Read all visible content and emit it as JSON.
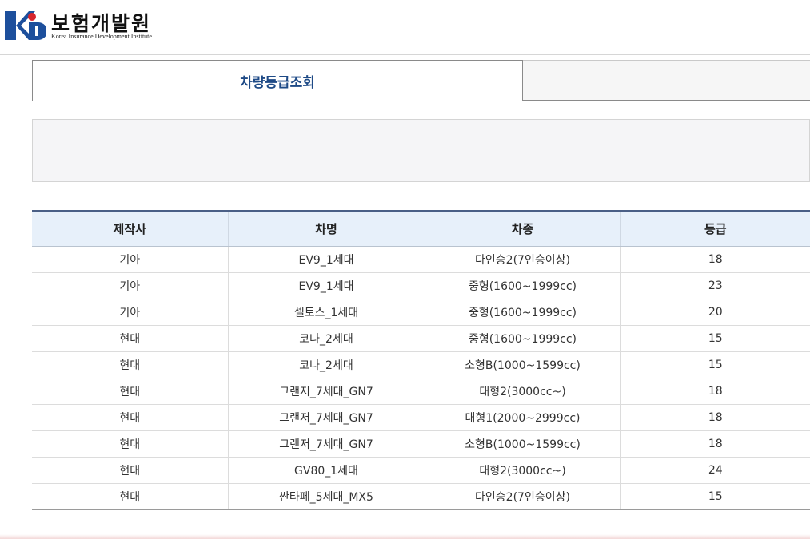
{
  "logo": {
    "title": "보험개발원",
    "subtitle": "Korea Insurance Development Institute",
    "icon": "kidi-logo-icon",
    "colors": {
      "blue": "#1d4f9c",
      "red": "#d7262e"
    }
  },
  "tabs": [
    {
      "label": "차량등급조회",
      "active": true
    },
    {
      "label": "",
      "active": false
    }
  ],
  "table": {
    "headers": [
      "제작사",
      "차명",
      "차종",
      "등급"
    ],
    "rows": [
      [
        "기아",
        "EV9_1세대",
        "다인승2(7인승이상)",
        "18"
      ],
      [
        "기아",
        "EV9_1세대",
        "중형(1600~1999cc)",
        "23"
      ],
      [
        "기아",
        "셀토스_1세대",
        "중형(1600~1999cc)",
        "20"
      ],
      [
        "현대",
        "코나_2세대",
        "중형(1600~1999cc)",
        "15"
      ],
      [
        "현대",
        "코나_2세대",
        "소형B(1000~1599cc)",
        "15"
      ],
      [
        "현대",
        "그랜저_7세대_GN7",
        "대형2(3000cc~)",
        "18"
      ],
      [
        "현대",
        "그랜저_7세대_GN7",
        "대형1(2000~2999cc)",
        "18"
      ],
      [
        "현대",
        "그랜저_7세대_GN7",
        "소형B(1000~1599cc)",
        "18"
      ],
      [
        "현대",
        "GV80_1세대",
        "대형2(3000cc~)",
        "24"
      ],
      [
        "현대",
        "싼타페_5세대_MX5",
        "다인승2(7인승이상)",
        "15"
      ]
    ]
  }
}
